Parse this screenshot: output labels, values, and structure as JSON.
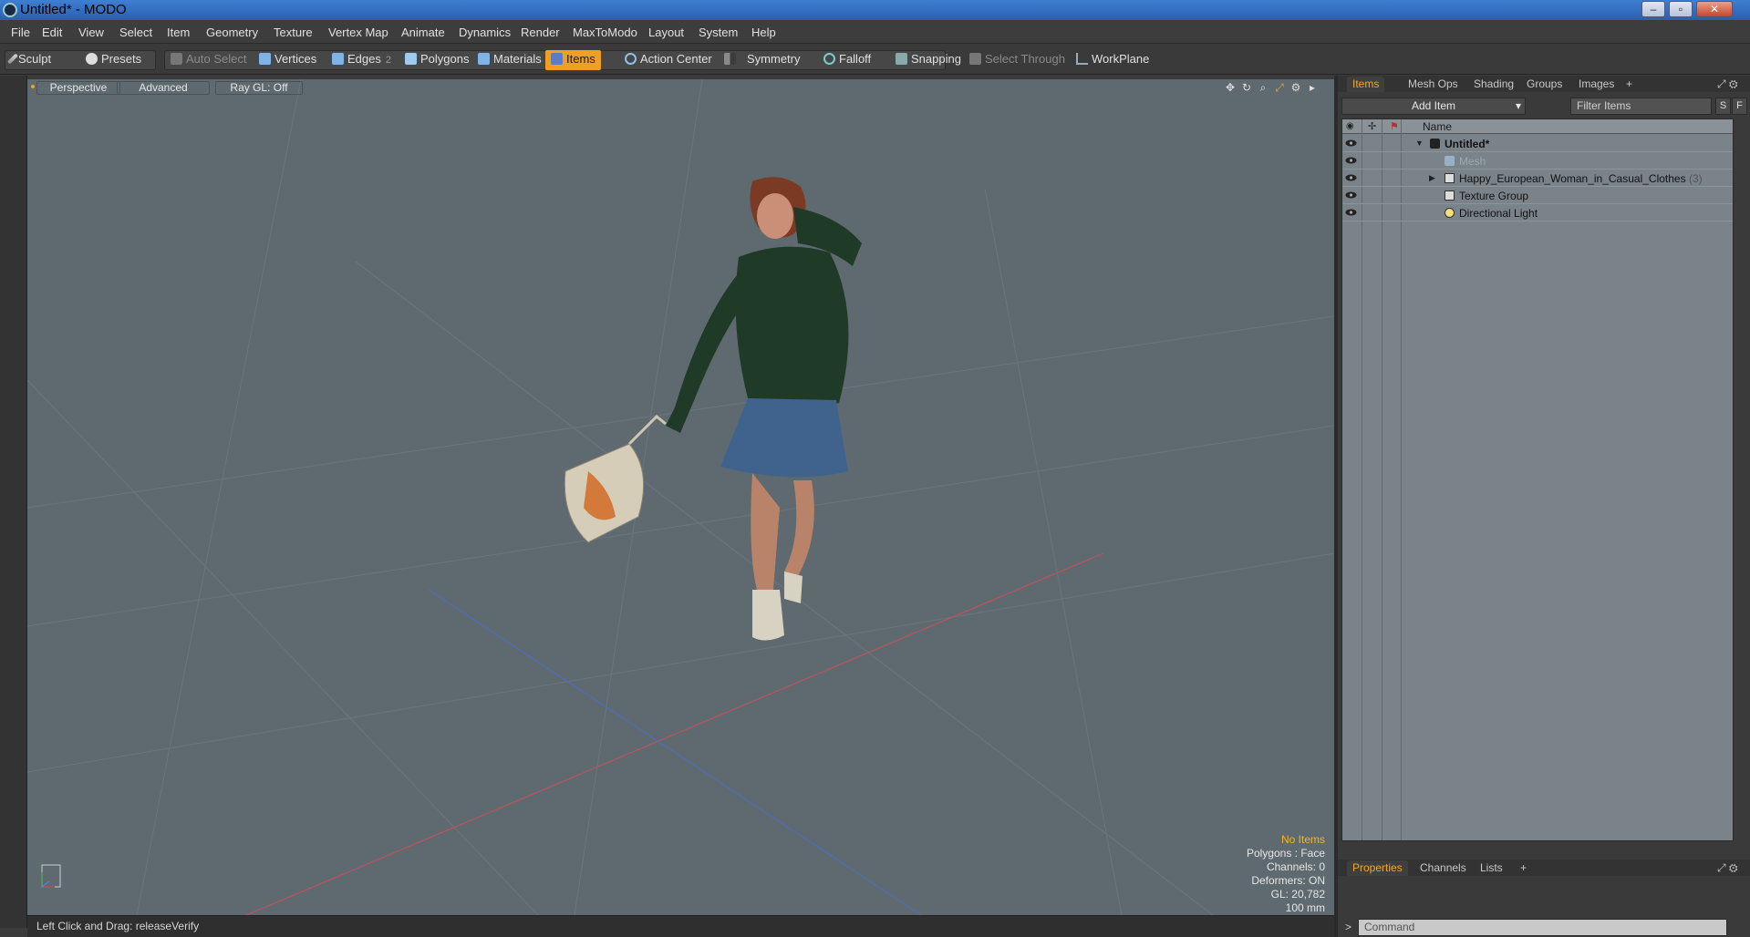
{
  "window": {
    "title": "Untitled* - MODO",
    "controls": [
      "–",
      "▫",
      "✕"
    ]
  },
  "menu": [
    "File",
    "Edit",
    "View",
    "Select",
    "Item",
    "Geometry",
    "Texture",
    "Vertex Map",
    "Animate",
    "Dynamics",
    "Render",
    "MaxToModo",
    "Layout",
    "System",
    "Help"
  ],
  "toolbar": {
    "sculpt": "Sculpt",
    "presets": "Presets",
    "auto_select": "Auto Select",
    "vertices": "Vertices",
    "edges": "Edges",
    "edges_count": "2",
    "polygons": "Polygons",
    "materials": "Materials",
    "items": "Items",
    "action_center": "Action Center",
    "symmetry": "Symmetry",
    "falloff": "Falloff",
    "snapping": "Snapping",
    "select_through": "Select Through",
    "workplane": "WorkPlane",
    "accent": "#f0a020"
  },
  "viewport": {
    "view_mode": "Perspective",
    "shading": "Advanced",
    "raygl": "Ray GL: Off",
    "info": {
      "selection": "No Items",
      "polygons": "Polygons : Face",
      "channels": "Channels: 0",
      "deformers": "Deformers: ON",
      "gl": "GL: 20,782",
      "grid": "100 mm"
    }
  },
  "status": {
    "hint": "Left Click and Drag:  releaseVerify"
  },
  "right_panel": {
    "top_tabs": [
      "Items",
      "Mesh Ops",
      "Shading",
      "Groups",
      "Images",
      "+"
    ],
    "add_item": "Add Item",
    "filter_placeholder": "Filter Items",
    "filter_s": "S",
    "filter_f": "F",
    "tree_column": "Name",
    "tree": {
      "root": "Untitled*",
      "mesh": "Mesh",
      "model": "Happy_European_Woman_in_Casual_Clothes",
      "model_count": "(3)",
      "texture_group": "Texture Group",
      "light": "Directional Light"
    },
    "bottom_tabs": [
      "Properties",
      "Channels",
      "Lists",
      "+"
    ],
    "command_placeholder": "Command",
    "command_prompt": ">"
  }
}
